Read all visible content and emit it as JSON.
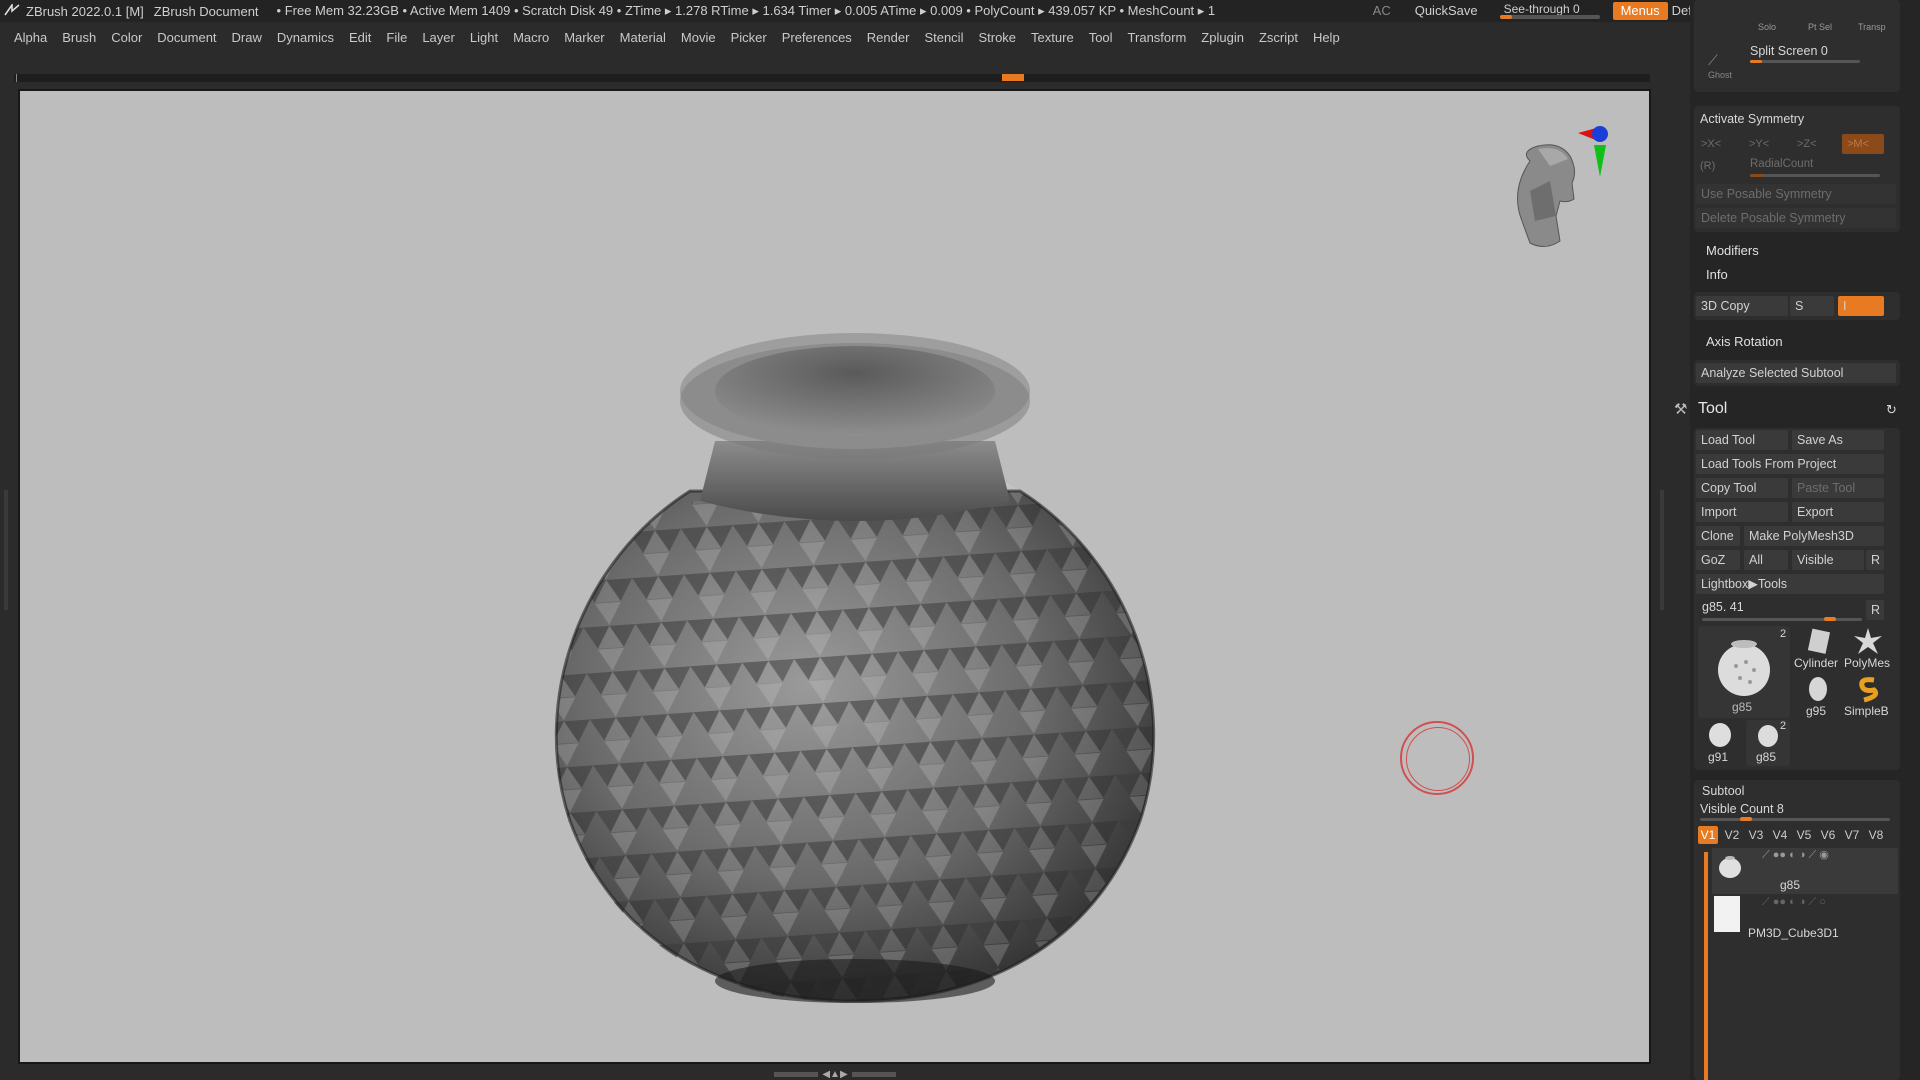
{
  "titlebar": {
    "app": "ZBrush 2022.0.1 [M]",
    "document": "ZBrush Document",
    "stats": "• Free Mem 32.23GB • Active Mem 1409 • Scratch Disk 49 •  ZTime ▸ 1.278 RTime ▸ 1.634 Timer ▸ 0.005 ATime ▸ 0.009 •  PolyCount ▸ 439.057 KP  • MeshCount ▸ 1",
    "ac": "AC",
    "quicksave": "QuickSave",
    "seethrough": "See-through  0",
    "menus": "Menus",
    "zscript": "DefaultZScript"
  },
  "menubar": [
    "Alpha",
    "Brush",
    "Color",
    "Document",
    "Draw",
    "Dynamics",
    "Edit",
    "File",
    "Layer",
    "Light",
    "Macro",
    "Marker",
    "Material",
    "Movie",
    "Picker",
    "Preferences",
    "Render",
    "Stencil",
    "Stroke",
    "Texture",
    "Tool",
    "Transform",
    "Zplugin",
    "Zscript",
    "Help"
  ],
  "panel": {
    "top_labels": {
      "solo": "Solo",
      "ptsel": "Pt Sel",
      "transp": "Transp",
      "ghost": "Ghost",
      "split_screen": "Split Screen 0"
    },
    "symmetry": {
      "activate": "Activate Symmetry",
      "x": ">X<",
      "y": ">Y<",
      "z": ">Z<",
      "m": ">M<",
      "r": "(R)",
      "radial": "RadialCount",
      "use_posable": "Use Posable Symmetry",
      "delete_posable": "Delete Posable Symmetry"
    },
    "modifiers": "Modifiers",
    "info": "Info",
    "copy3d": "3D Copy",
    "s": "S",
    "i": "I",
    "axis_rotation": "Axis Rotation",
    "analyze": "Analyze Selected Subtool",
    "tool": {
      "title": "Tool",
      "load_tool": "Load Tool",
      "save_as": "Save As",
      "load_from_project": "Load Tools From Project",
      "copy_tool": "Copy Tool",
      "paste_tool": "Paste Tool",
      "import": "Import",
      "export": "Export",
      "clone": "Clone",
      "make_polymesh": "Make PolyMesh3D",
      "goz": "GoZ",
      "all": "All",
      "visible": "Visible",
      "r": "R",
      "lightbox": "Lightbox▶Tools",
      "current": "g85. 41",
      "current_r": "R",
      "thumbs": [
        {
          "name": "g85",
          "count": "2"
        },
        {
          "name": "Cylinder"
        },
        {
          "name": "PolyMes"
        },
        {
          "name": "g95"
        },
        {
          "name": "SimpleB"
        },
        {
          "name": "g91"
        },
        {
          "name": "g85",
          "count": "2"
        }
      ]
    },
    "subtool": {
      "title": "Subtool",
      "visible_count": "Visible Count 8",
      "tabs": [
        "V1",
        "V2",
        "V3",
        "V4",
        "V5",
        "V6",
        "V7",
        "V8"
      ],
      "items": [
        {
          "name": "g85"
        },
        {
          "name": "PM3D_Cube3D1"
        }
      ]
    }
  },
  "colors": {
    "accent": "#e87b21",
    "canvas_bg": "#bdbdbd",
    "panel_bg": "#252525"
  }
}
